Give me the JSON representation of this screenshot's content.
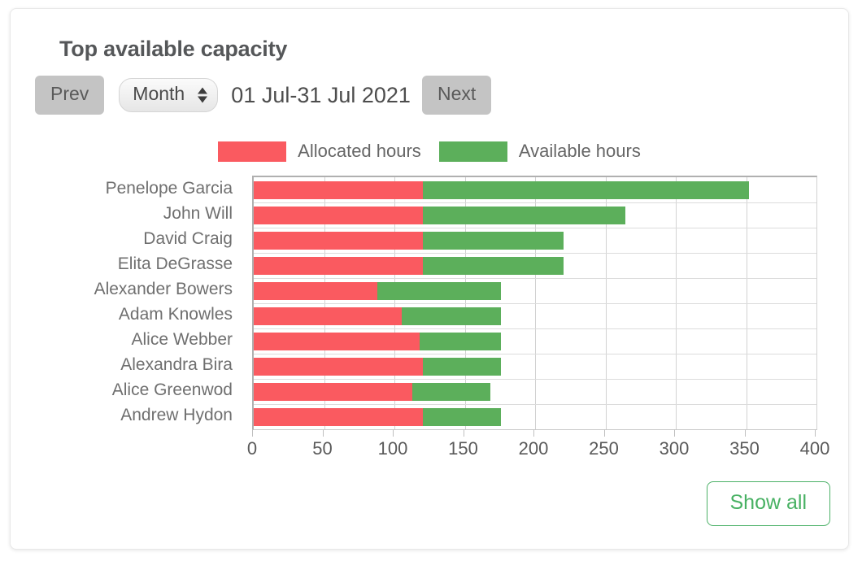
{
  "widget": {
    "title": "Top available capacity"
  },
  "toolbar": {
    "prev_label": "Prev",
    "next_label": "Next",
    "period_selected": "Month",
    "period_options": [
      "Month"
    ],
    "date_range": "01 Jul-31 Jul 2021"
  },
  "footer": {
    "show_all_label": "Show all"
  },
  "colors": {
    "allocated": "#fa5a60",
    "available": "#5caf5b",
    "accent_green": "#4cb168",
    "button_grey": "#c4c4c4",
    "title_grey": "#555759"
  },
  "chart_data": {
    "type": "bar",
    "orientation": "horizontal",
    "stacked": true,
    "title": "Top available capacity",
    "xlabel": "",
    "ylabel": "",
    "xlim": [
      0,
      400
    ],
    "xticks": [
      0,
      50,
      100,
      150,
      200,
      250,
      300,
      350,
      400
    ],
    "grid": true,
    "legend_position": "top-center",
    "categories": [
      "Penelope Garcia",
      "John Will",
      "David Craig",
      "Elita DeGrasse",
      "Alexander Bowers",
      "Adam Knowles",
      "Alice Webber",
      "Alexandra Bira",
      "Alice Greenwod",
      "Andrew Hydon"
    ],
    "series": [
      {
        "name": "Allocated hours",
        "color": "#fa5a60",
        "values": [
          120,
          120,
          120,
          120,
          88,
          105,
          118,
          120,
          113,
          120
        ]
      },
      {
        "name": "Available hours",
        "color": "#5caf5b",
        "values": [
          232,
          144,
          100,
          100,
          88,
          71,
          58,
          56,
          55,
          56
        ]
      }
    ],
    "totals": [
      352,
      264,
      220,
      220,
      176,
      176,
      176,
      176,
      168,
      176
    ]
  }
}
